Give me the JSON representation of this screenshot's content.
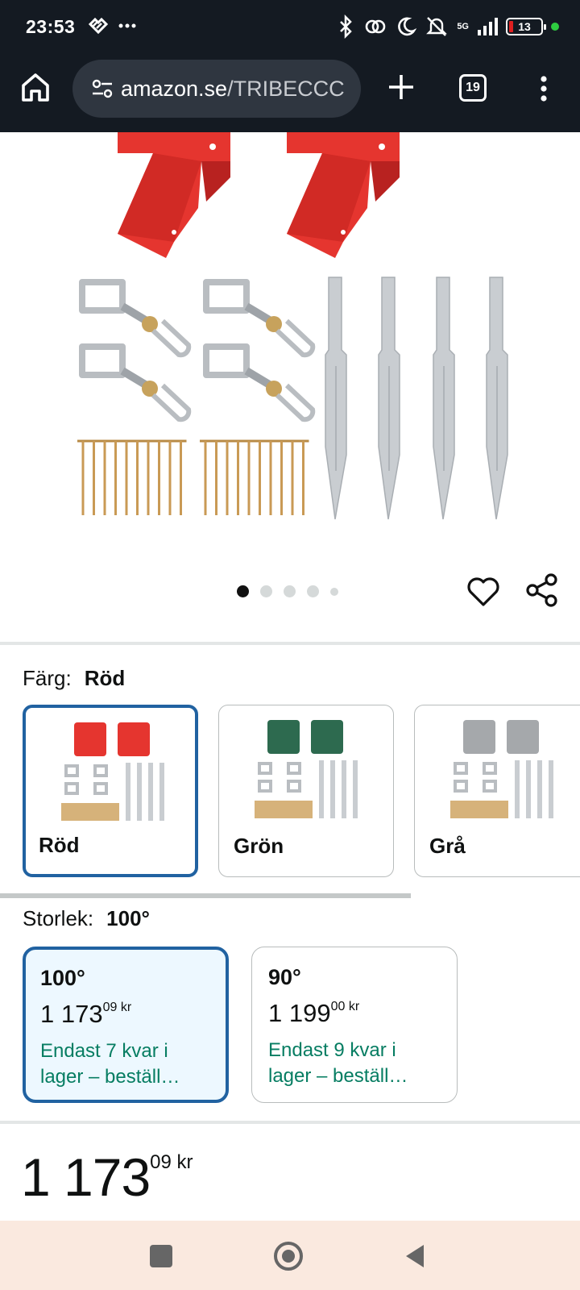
{
  "status_bar": {
    "time": "23:53",
    "battery": "13",
    "network": "5G",
    "icons": [
      "heart-pulse-icon",
      "more-dots-icon",
      "bluetooth-icon",
      "link-icon",
      "moon-icon",
      "bell-off-icon",
      "signal-icon",
      "battery-icon",
      "green-dot-icon"
    ]
  },
  "browser": {
    "url_domain": "amazon.se",
    "url_path": "/TRIBECCC",
    "tab_count": "19",
    "icons": [
      "home-icon",
      "tune-icon",
      "plus-icon",
      "tabs-icon",
      "more-vert-icon"
    ]
  },
  "product": {
    "image_alt": "Swing brackets kit",
    "image_index": 1,
    "image_count": 5,
    "colors": {
      "red": "#e5352f",
      "green": "#2d6a4f",
      "gray": "#a5a8ab",
      "steel": "#c8ccd0",
      "screw": "#c99a55"
    }
  },
  "variants": {
    "color_label": "Färg:",
    "color_selected": "Röd",
    "color_options": [
      {
        "label": "Röd",
        "selected": true
      },
      {
        "label": "Grön",
        "selected": false
      },
      {
        "label": "Grå",
        "selected": false
      }
    ],
    "size_label": "Storlek:",
    "size_selected": "100°",
    "size_options": [
      {
        "title": "100°",
        "price_whole": "1 173",
        "price_fraction": "09",
        "currency": "kr",
        "stock_line1": "Endast 7 kvar i",
        "stock_line2": "lager – beställ…",
        "selected": true
      },
      {
        "title": "90°",
        "price_whole": "1 199",
        "price_fraction": "00",
        "currency": "kr",
        "stock_line1": "Endast 9 kvar i",
        "stock_line2": "lager – beställ…",
        "selected": false
      }
    ]
  },
  "price": {
    "whole": "1 173",
    "fraction": "09",
    "currency": "kr"
  },
  "nav": {
    "icons": [
      "recents-icon",
      "home-circle-icon",
      "back-icon"
    ]
  }
}
